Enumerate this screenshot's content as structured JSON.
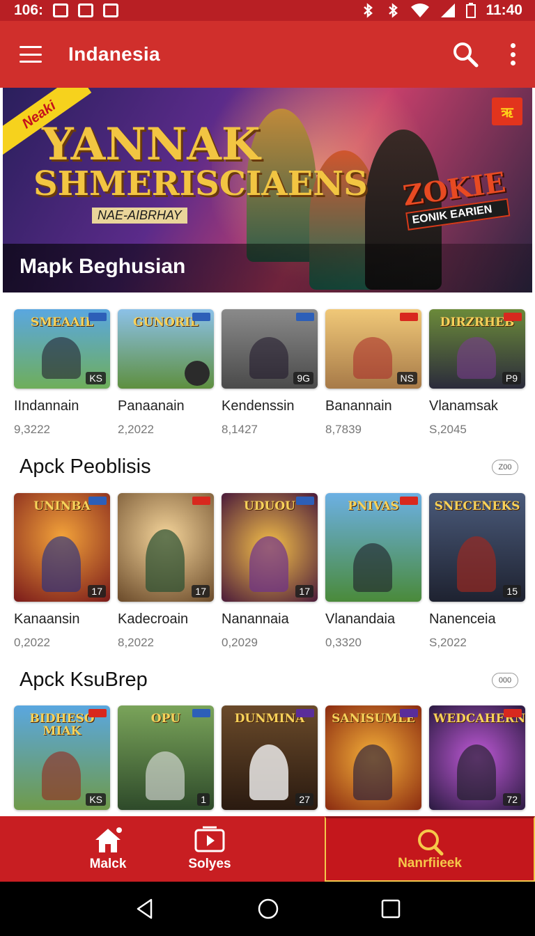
{
  "status_bar": {
    "left_text": "106:",
    "time": "11:40"
  },
  "app_bar": {
    "title": "Indanesia",
    "menu_icon": "hamburger-menu-icon",
    "search_icon": "search-icon",
    "more_icon": "more-vertical-icon"
  },
  "banner": {
    "ribbon": "Neaki",
    "title_line1": "YANNAK",
    "title_line2": "SHMERISCIAENS",
    "title_line3": "NAE-AIBRHAY",
    "sign_line1": "ZOKIE",
    "sign_line2": "EONIK EARIEN",
    "corner_badge": "ऋ",
    "caption": "Mapk Beghusian"
  },
  "section1": {
    "items": [
      {
        "thumb_title": "SMEAAIL",
        "name": "IIndannain",
        "count": "9,3222",
        "badge": "KS"
      },
      {
        "thumb_title": "GUNORIL",
        "name": "Panaanain",
        "count": "2,2022",
        "badge": ""
      },
      {
        "thumb_title": "",
        "name": "Kendenssin",
        "count": "8,1427",
        "badge": "9G"
      },
      {
        "thumb_title": "",
        "name": "Banannain",
        "count": "8,7839",
        "badge": "NS"
      },
      {
        "thumb_title": "DIRZRHEB",
        "name": "Vlanamsak",
        "count": "S,2045",
        "badge": "P9"
      }
    ]
  },
  "section2": {
    "title": "Apck Peoblisis",
    "more_label": "Z00",
    "items": [
      {
        "thumb_title": "UNINBA",
        "name": "Kanaansin",
        "count": "0,2022",
        "badge": "17"
      },
      {
        "thumb_title": "",
        "name": "Kadecroain",
        "count": "8,2022",
        "badge": "17"
      },
      {
        "thumb_title": "UDUOU",
        "name": "Nanannaia",
        "count": "0,2029",
        "badge": "17"
      },
      {
        "thumb_title": "PNIVAS",
        "name": "Vlanandaia",
        "count": "0,3320",
        "badge": ""
      },
      {
        "thumb_title": "SNECENEKS",
        "name": "Nanenceia",
        "count": "S,2022",
        "badge": "15"
      }
    ]
  },
  "section3": {
    "title": "Apck KsuBrep",
    "more_label": "000",
    "items": [
      {
        "thumb_title": "BIDHESO MIAK",
        "badge": "KS"
      },
      {
        "thumb_title": "OPU",
        "badge": "1"
      },
      {
        "thumb_title": "DUNMINA",
        "badge": "27"
      },
      {
        "thumb_title": "SANISUMLE",
        "badge": ""
      },
      {
        "thumb_title": "WEDCAHERN",
        "badge": "72"
      }
    ]
  },
  "bottom_nav": {
    "items": [
      {
        "label": "Malck",
        "icon": "home-icon"
      },
      {
        "label": "Solyes",
        "icon": "video-icon"
      },
      {
        "label": "Nanrfiieek",
        "icon": "search-icon"
      }
    ]
  },
  "colors": {
    "primary": "#d02f2c",
    "nav": "#c81e22",
    "accent": "#f6c84a"
  }
}
